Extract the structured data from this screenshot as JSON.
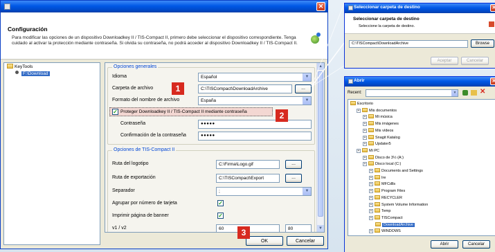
{
  "main": {
    "heading": "Configuración",
    "description": "Para modificar las opciones de un dispositivo Downloadkey II / TIS-Compact II, primero debe seleccionar el dispositivo correspondiente. Tenga cuidado al activar la protección mediante contraseña. Si olvida su contraseña, no podrá acceder al dispositivo Downloadkey II / TIS-Compact II.",
    "tree": {
      "root": "KeyTools",
      "child": "F:\\Download"
    },
    "general": {
      "title": "Opciones generales",
      "idioma_label": "Idioma",
      "idioma_value": "Español",
      "carpeta_label": "Carpeta de archivo",
      "carpeta_value": "C:\\TISCompact\\DownloadArchive",
      "formato_label": "Formato del nombre de archivo",
      "formato_value": "España",
      "protect_label": "Proteger Downloadkey II / TIS-Compact II mediante contraseña",
      "pw_label": "Contraseña",
      "pw_value": "●●●●●",
      "pw_confirm_label": "Confirmación de la contraseña",
      "pw_confirm_value": "●●●●●"
    },
    "tis": {
      "title": "Opciones de TIS-Compact II",
      "logo_label": "Ruta del logotipo",
      "logo_value": "C:\\Firma\\Logo.gif",
      "export_label": "Ruta de exportación",
      "export_value": "C:\\TISCompact\\Export",
      "sep_label": "Separador",
      "sep_value": ";",
      "card_label": "Agrupar por número de tarjeta",
      "banner_label": "Imprimir página de banner",
      "v1v2_label": "v1 / v2",
      "v1_value": "60",
      "v2_value": "80"
    },
    "browse": "...",
    "ok": "OK",
    "cancel": "Cancelar",
    "badges": [
      "1",
      "2",
      "3"
    ]
  },
  "folder_dialog": {
    "title": "Seleccionar carpeta de destino",
    "heading": "Seleccionar carpeta de destino",
    "sub": "Seleccione la carpeta de destino.",
    "path": "C:\\TISCompact\\DownloadArchive",
    "browse": "Browse",
    "accept": "Aceptar",
    "cancel": "Cancelar"
  },
  "open_dialog": {
    "title": "Abrir",
    "recent_label": "Recent:",
    "items": [
      "Escritorio",
      "Mis documentos",
      "Mi música",
      "Mis imágenes",
      "Mis vídeos",
      "Snagit Katalog",
      "Updater5",
      "Mi PC",
      "Disco de 3½ (A:)",
      "Disco local (C:)",
      "Documents and Settings",
      "Ire",
      "MFCdlls",
      "Program Files",
      "RECYCLER",
      "System Volume Information",
      "Temp",
      "TISCompact",
      "DownloadArchive",
      "WINDOWS"
    ],
    "open": "Abrir",
    "cancel": "Cancelar"
  }
}
